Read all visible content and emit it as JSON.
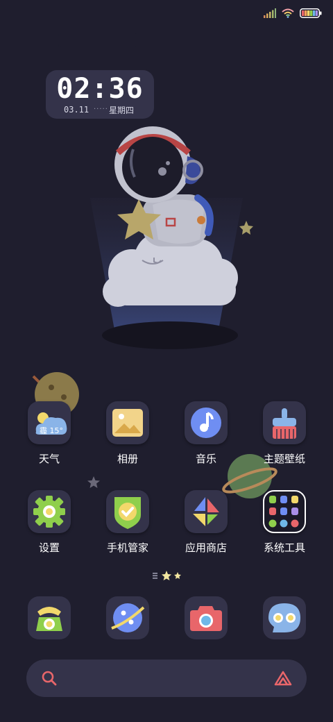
{
  "status_bar": {
    "signal_icon": "signal-icon",
    "wifi_icon": "wifi-icon",
    "battery_icon": "battery-icon"
  },
  "clock_widget": {
    "time": "02:36",
    "date": "03.11",
    "dots": "·····",
    "weekday": "星期四"
  },
  "weather": {
    "temp": "15°",
    "condition_glyph": "霾"
  },
  "apps_row1": [
    {
      "label": "天气",
      "icon": "weather-icon"
    },
    {
      "label": "相册",
      "icon": "gallery-icon"
    },
    {
      "label": "音乐",
      "icon": "music-icon"
    },
    {
      "label": "主题壁纸",
      "icon": "theme-brush-icon"
    }
  ],
  "apps_row2": [
    {
      "label": "设置",
      "icon": "gear-icon"
    },
    {
      "label": "手机管家",
      "icon": "shield-check-icon"
    },
    {
      "label": "应用商店",
      "icon": "app-store-icon"
    },
    {
      "label": "系统工具",
      "icon": "folder-icon"
    }
  ],
  "dock": [
    {
      "icon": "phone-icon"
    },
    {
      "icon": "browser-planet-icon"
    },
    {
      "icon": "camera-icon"
    },
    {
      "icon": "messages-icon"
    }
  ],
  "search_bar": {
    "search_icon": "search-icon",
    "assistant_icon": "assistant-icon"
  },
  "colors": {
    "background": "#1f1e2e",
    "tile": "#34334a",
    "accent_coral": "#e8666a",
    "accent_green": "#8fcf4c",
    "accent_yellow": "#f2d86b",
    "accent_blue": "#6f8ef2"
  }
}
